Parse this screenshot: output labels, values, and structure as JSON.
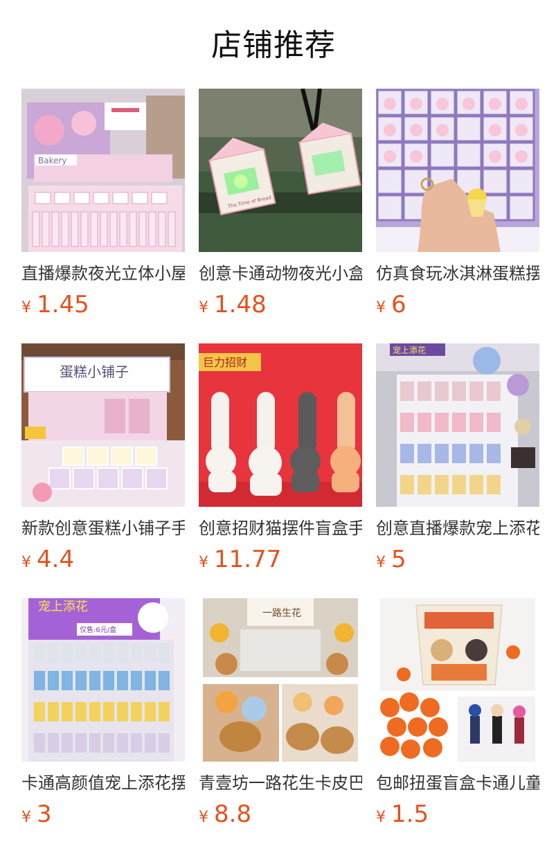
{
  "page": {
    "title": "店铺推荐"
  },
  "products": [
    {
      "name": "直播爆款夜光立体小屋",
      "currency": "¥",
      "price": "1.45"
    },
    {
      "name": "创意卡通动物夜光小盒子",
      "currency": "¥",
      "price": "1.48"
    },
    {
      "name": "仿真食玩冰淇淋蛋糕摆件",
      "currency": "¥",
      "price": "6"
    },
    {
      "name": "新款创意蛋糕小铺子手办",
      "currency": "¥",
      "price": "4.4"
    },
    {
      "name": "创意招财猫摆件盲盒手办",
      "currency": "¥",
      "price": "11.77"
    },
    {
      "name": "创意直播爆款宠上添花摆件",
      "currency": "¥",
      "price": "5"
    },
    {
      "name": "卡通高颜值宠上添花摆件",
      "currency": "¥",
      "price": "3"
    },
    {
      "name": "青壹坊一路花生卡皮巴拉",
      "currency": "¥",
      "price": "8.8"
    },
    {
      "name": "包邮扭蛋盲盒卡通儿童玩具",
      "currency": "¥",
      "price": "1.5"
    }
  ],
  "images": {
    "p1": {
      "icon": "bakery-shop-image",
      "sign_text": "Bakery"
    },
    "p2": {
      "icon": "glow-box-keychain-image",
      "box_text": "The Time of Bread"
    },
    "p3": {
      "icon": "icecream-cake-shelf-image"
    },
    "p4": {
      "icon": "cake-shop-image",
      "sign_text": "蛋糕小铺子"
    },
    "p5": {
      "icon": "lucky-cat-image",
      "banner_text": "巨力招财"
    },
    "p6": {
      "icon": "pet-flower-shelf-image",
      "sign_text": "宠上添花"
    },
    "p7": {
      "icon": "pet-flower-display-image",
      "sign_text": "宠上添花",
      "price_tag": "仅售:6元/盒"
    },
    "p8": {
      "icon": "capybara-flower-image",
      "sign_text": "一路生花"
    },
    "p9": {
      "icon": "gashapon-bucket-image"
    }
  },
  "colors": {
    "price": "#e5511d",
    "name": "#333333",
    "title": "#111111"
  }
}
